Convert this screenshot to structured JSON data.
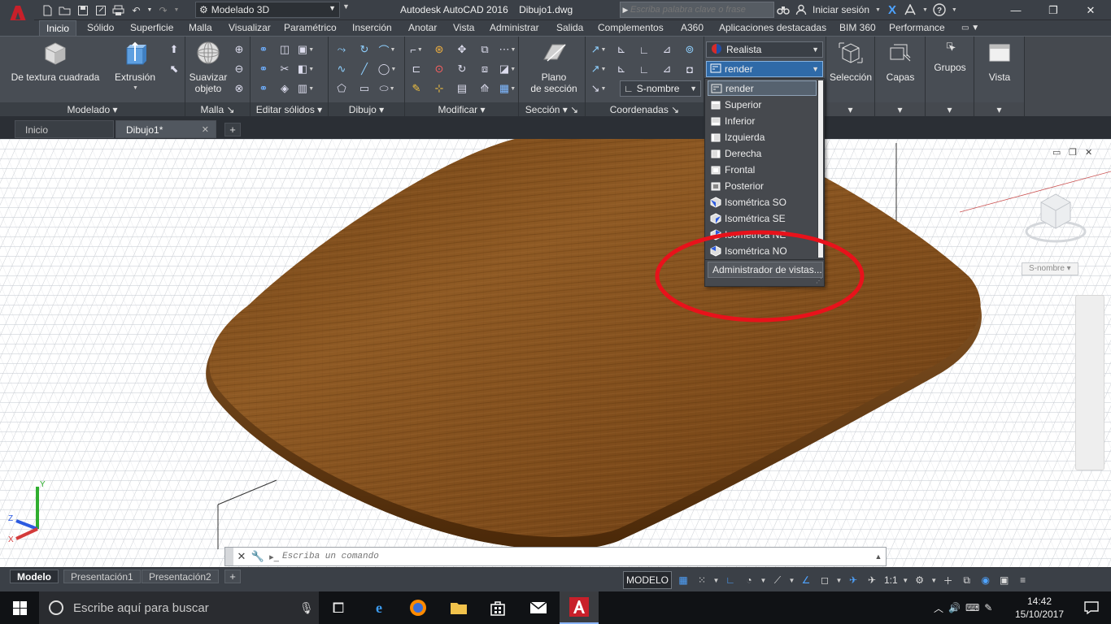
{
  "titlebar": {
    "workspace": "Modelado 3D",
    "app_name": "Autodesk AutoCAD 2016",
    "doc_name": "Dibujo1.dwg",
    "search_placeholder": "Escriba palabra clave o frase",
    "sign_in": "Iniciar sesión"
  },
  "ribbon_tabs": [
    "Inicio",
    "Sólido",
    "Superficie",
    "Malla",
    "Visualizar",
    "Paramétrico",
    "Inserción",
    "Anotar",
    "Vista",
    "Administrar",
    "Salida",
    "Complementos",
    "A360",
    "Aplicaciones destacadas",
    "BIM 360",
    "Performance"
  ],
  "ribbon": {
    "modelado": {
      "title": "Modelado",
      "box_label": "De textura cuadrada",
      "extrude_label": "Extrusión"
    },
    "malla": {
      "title": "Malla",
      "smooth_label_1": "Suavizar",
      "smooth_label_2": "objeto"
    },
    "editar": {
      "title": "Editar sólidos"
    },
    "dibujo": {
      "title": "Dibujo"
    },
    "modificar": {
      "title": "Modificar"
    },
    "seccion": {
      "title": "Sección",
      "plane_label_1": "Plano",
      "plane_label_2": "de sección"
    },
    "coordenadas": {
      "title": "Coordenadas",
      "ucs_combo": "S-nombre"
    },
    "vistas": {
      "visual_style": "Realista",
      "named_view": "render"
    },
    "seleccion": {
      "label": "Selección"
    },
    "capas": {
      "label": "Capas"
    },
    "grupos": {
      "label": "Grupos"
    },
    "vista": {
      "label": "Vista"
    }
  },
  "views_dropdown": {
    "items": [
      {
        "label": "render",
        "selected": true,
        "icon": "named-view-icon"
      },
      {
        "label": "Superior",
        "icon": "view-top-icon"
      },
      {
        "label": "Inferior",
        "icon": "view-bottom-icon"
      },
      {
        "label": "Izquierda",
        "icon": "view-left-icon"
      },
      {
        "label": "Derecha",
        "icon": "view-right-icon"
      },
      {
        "label": "Frontal",
        "icon": "view-front-icon"
      },
      {
        "label": "Posterior",
        "icon": "view-back-icon"
      },
      {
        "label": "Isométrica SO",
        "icon": "iso-sw-icon"
      },
      {
        "label": "Isométrica SE",
        "icon": "iso-se-icon"
      },
      {
        "label": "Isométrica NE",
        "icon": "iso-ne-icon"
      },
      {
        "label": "Isométrica NO",
        "icon": "iso-nw-icon"
      }
    ],
    "manager": "Administrador de vistas..."
  },
  "doc_tabs": {
    "home": "Inicio",
    "drawing": "Dibujo1*"
  },
  "viewport": {
    "viewcube_label": "S-nombre",
    "command_placeholder": "Escriba un comando",
    "ucs_x": "X",
    "ucs_y": "Y",
    "ucs_z": "Z"
  },
  "layout_tabs": [
    "Modelo",
    "Presentación1",
    "Presentación2"
  ],
  "status": {
    "space": "MODELO",
    "scale": "1:1"
  },
  "taskbar": {
    "search_placeholder": "Escribe aquí para buscar",
    "time": "14:42",
    "date": "15/10/2017"
  },
  "colors": {
    "annotation_red": "#e8121b",
    "wood_mid": "#8a5420",
    "wood_dark": "#5e3410",
    "autocad_red": "#c8202a"
  }
}
